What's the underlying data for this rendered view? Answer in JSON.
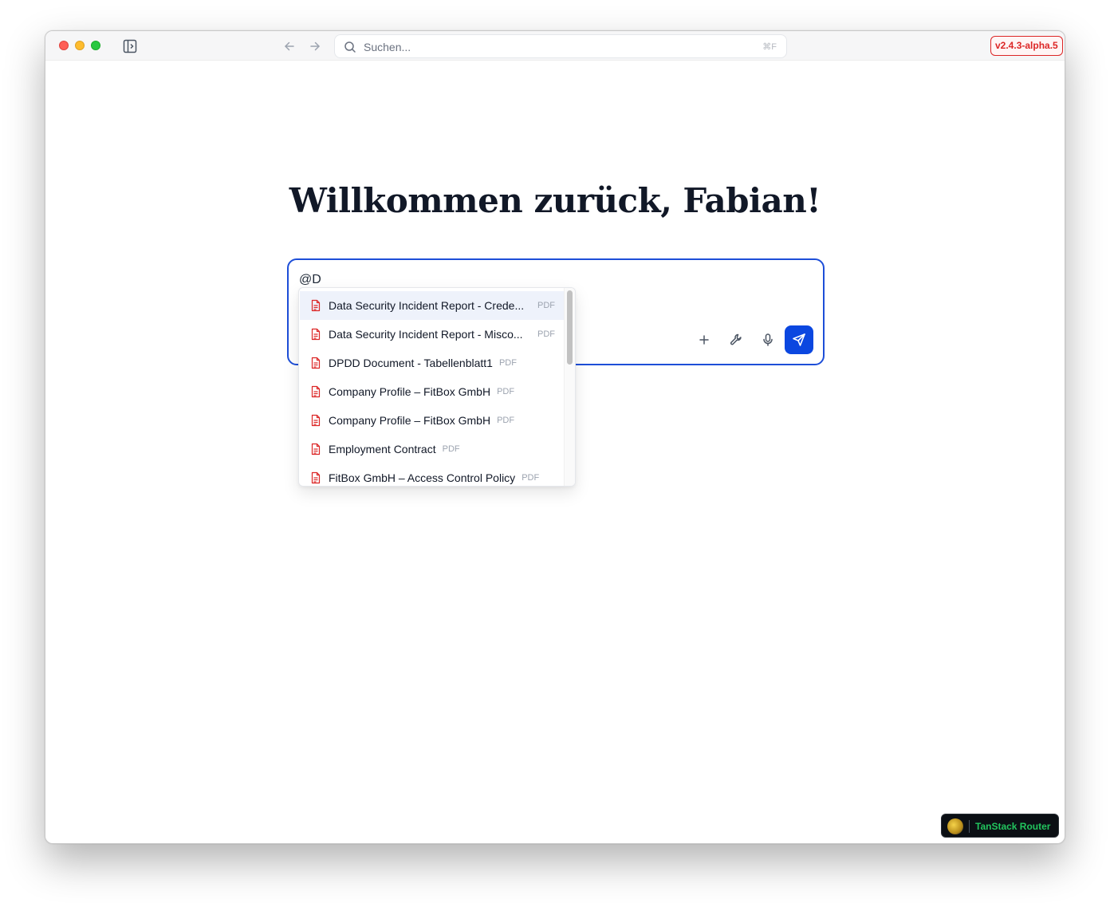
{
  "titlebar": {
    "search_placeholder": "Suchen...",
    "search_shortcut": "⌘F",
    "version_badge": "v2.4.3-alpha.5"
  },
  "main": {
    "headline": "Willkommen zurück, Fabian!"
  },
  "composer": {
    "input_value": "@D"
  },
  "mention_dropdown": {
    "items": [
      {
        "name": "Data Security Incident Report - Crede...",
        "type": "PDF"
      },
      {
        "name": "Data Security Incident Report - Misco...",
        "type": "PDF"
      },
      {
        "name": "DPDD Document - Tabellenblatt1",
        "type": "PDF"
      },
      {
        "name": "Company Profile – FitBox GmbH",
        "type": "PDF"
      },
      {
        "name": "Company Profile – FitBox GmbH",
        "type": "PDF"
      },
      {
        "name": "Employment Contract",
        "type": "PDF"
      },
      {
        "name": "FitBox GmbH – Access Control Policy",
        "type": "PDF"
      }
    ]
  },
  "devtools": {
    "label": "TanStack Router"
  },
  "colors": {
    "accent": "#0b47e0",
    "version_badge": "#dc2626",
    "pdf_icon": "#dc2626",
    "devtools_label": "#22c55e"
  },
  "icons": [
    "sidebar-toggle-icon",
    "arrow-left-icon",
    "arrow-right-icon",
    "search-icon",
    "plus-icon",
    "wrench-icon",
    "microphone-icon",
    "send-icon",
    "pdf-file-icon"
  ]
}
